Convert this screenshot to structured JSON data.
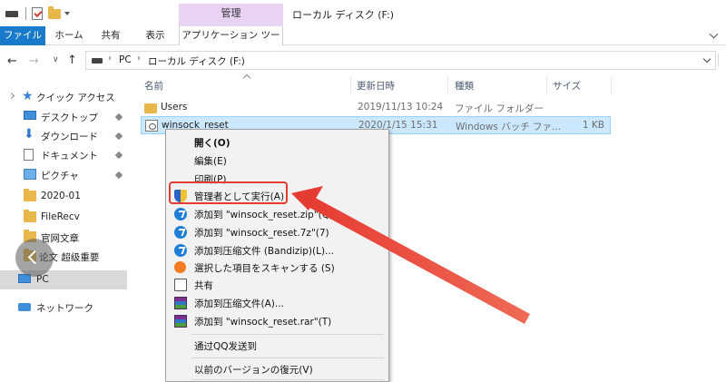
{
  "titlebar": {
    "context_group": "管理",
    "window_title": "ローカル ディスク (F:)"
  },
  "ribbon": {
    "tabs": [
      {
        "label": "ファイル"
      },
      {
        "label": "ホーム"
      },
      {
        "label": "共有"
      },
      {
        "label": "表示"
      },
      {
        "label": "アプリケーション ツール"
      }
    ]
  },
  "address": {
    "segments": [
      "PC",
      "ローカル ディスク (F:)"
    ]
  },
  "navpane": {
    "quick_access": "クイック アクセス",
    "items": [
      {
        "label": "デスクトップ",
        "icon": "desktop-icon"
      },
      {
        "label": "ダウンロード",
        "icon": "download-icon"
      },
      {
        "label": "ドキュメント",
        "icon": "documents-icon"
      },
      {
        "label": "ピクチャ",
        "icon": "pictures-icon"
      },
      {
        "label": "2020-01",
        "icon": "folder-icon"
      },
      {
        "label": "FileRecv",
        "icon": "folder-icon"
      },
      {
        "label": "官网文章",
        "icon": "folder-icon"
      },
      {
        "label": "论文 超级重要",
        "icon": "folder-icon"
      }
    ],
    "pc": "PC",
    "network": "ネットワーク"
  },
  "filelist": {
    "columns": [
      "名前",
      "更新日時",
      "種類",
      "サイズ"
    ],
    "rows": [
      {
        "name": "Users",
        "date": "2019/11/13 10:24",
        "type": "ファイル フォルダー",
        "size": ""
      },
      {
        "name": "winsock_reset",
        "date": "2020/1/15 15:31",
        "type": "Windows バッチ ファ...",
        "size": "1 KB"
      }
    ]
  },
  "context_menu": {
    "items": [
      {
        "label": "開く(O)"
      },
      {
        "label": "編集(E)"
      },
      {
        "label": "印刷(P)"
      },
      {
        "label": "管理者として実行(A)",
        "icon": "uac-shield-icon"
      },
      {
        "label": "添加到 \"winsock_reset.zip\"(Q)",
        "icon": "bandizip-icon"
      },
      {
        "label": "添加到 \"winsock_reset.7z\"(7)",
        "icon": "bandizip-icon"
      },
      {
        "label": "添加到压缩文件 (Bandizip)(L)...",
        "icon": "bandizip-icon"
      },
      {
        "label": "選択した項目をスキャンする (S)",
        "icon": "avast-icon"
      },
      {
        "label": "共有",
        "icon": "share-icon"
      },
      {
        "label": "添加到压缩文件(A)...",
        "icon": "winrar-icon"
      },
      {
        "label": "添加到 \"winsock_reset.rar\"(T)",
        "icon": "winrar-icon"
      },
      {
        "label": "通过QQ发送到"
      },
      {
        "label": "以前のバージョンの復元(V)"
      }
    ]
  },
  "annotation": {
    "color": "#e63b32"
  }
}
